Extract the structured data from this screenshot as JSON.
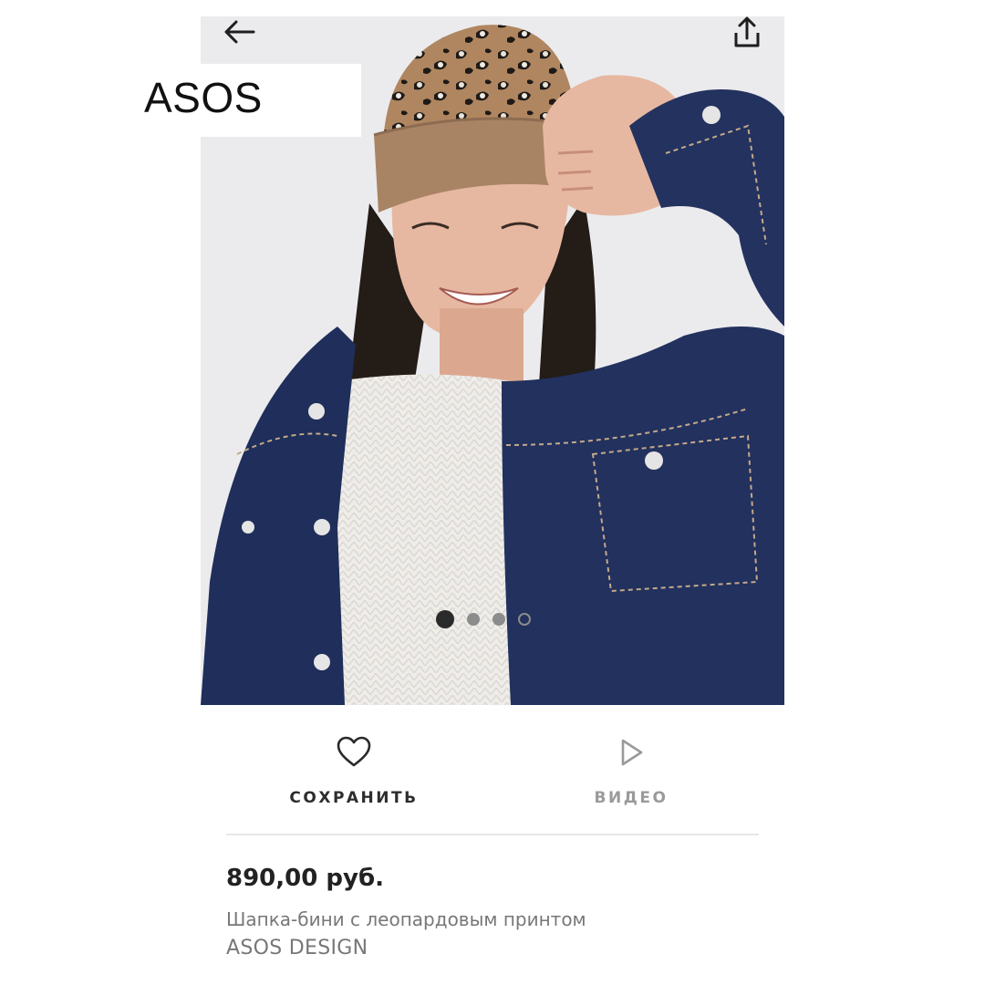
{
  "brand_label": "ASOS",
  "gallery": {
    "image": "product-photo-woman-leopard-beanie-denim-jacket",
    "slide_count": 4,
    "active_slide": 1
  },
  "actions": {
    "save_label": "СОХРАНИТЬ",
    "video_label": "ВИДЕО"
  },
  "product": {
    "price": "890,00 руб.",
    "name": "Шапка-бини с леопардовым принтом",
    "brand": "ASOS DESIGN"
  },
  "icons": {
    "back": "arrow-left-icon",
    "share": "share-icon",
    "save": "heart-icon",
    "video": "play-icon"
  },
  "colors": {
    "text_dark": "#222222",
    "text_muted": "#777777",
    "label_inactive": "#9a9a9a",
    "dot_active": "#2b2b2b",
    "dot_inactive": "#8c8c8c"
  }
}
